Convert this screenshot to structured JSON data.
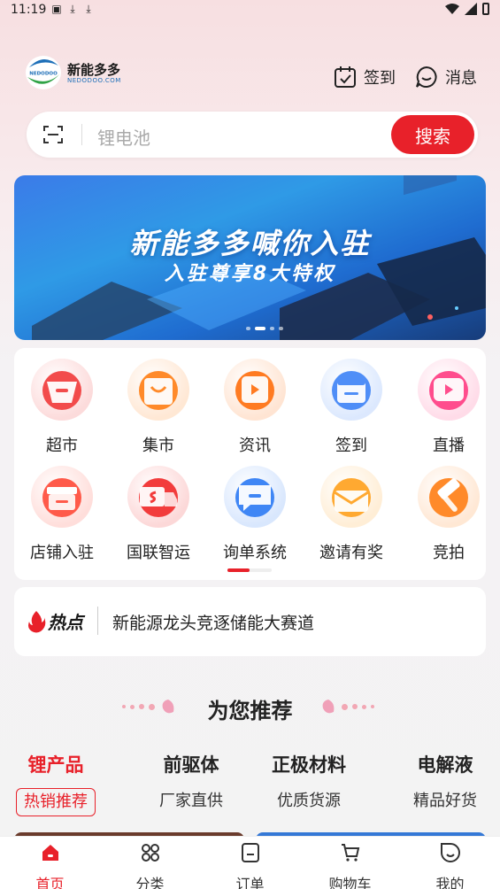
{
  "status_bar": {
    "time": "11:19"
  },
  "header": {
    "logo_text": "新能多多",
    "logo_subtext": "NEDODOO.COM",
    "logo_mark_text": "NEDODOO",
    "checkin_label": "签到",
    "message_label": "消息"
  },
  "search": {
    "placeholder": "锂电池",
    "button_label": "搜索"
  },
  "banner": {
    "title": "新能多多喊你入驻",
    "subtitle": "入驻尊享8大特权",
    "slide_count": 4,
    "active_slide": 2
  },
  "quick_menu": {
    "items": [
      {
        "label": "超市",
        "icon": "basket-icon",
        "color": "#f24b4b"
      },
      {
        "label": "集市",
        "icon": "bag-icon",
        "color": "#ff8a2a"
      },
      {
        "label": "资讯",
        "icon": "news-play-icon",
        "color": "#ff7b22"
      },
      {
        "label": "签到",
        "icon": "calendar-icon",
        "color": "#4f8ef7"
      },
      {
        "label": "直播",
        "icon": "live-play-icon",
        "color": "#ff4d8d"
      },
      {
        "label": "店铺入驻",
        "icon": "store-icon",
        "color": "#ff5a4a"
      },
      {
        "label": "国联智运",
        "icon": "truck-icon",
        "color": "#f23c3c"
      },
      {
        "label": "询单系统",
        "icon": "chat-bubble-icon",
        "color": "#3f86f5"
      },
      {
        "label": "邀请有奖",
        "icon": "envelope-icon",
        "color": "#ffa931"
      },
      {
        "label": "竞拍",
        "icon": "gavel-icon",
        "color": "#ff8a2a"
      }
    ],
    "page_count": 2,
    "active_page": 1
  },
  "news": {
    "tag": "热点",
    "headline": "新能源龙头竞逐储能大赛道"
  },
  "recommend": {
    "title": "为您推荐",
    "categories": [
      {
        "name": "锂产品",
        "sub": "热销推荐",
        "active": true
      },
      {
        "name": "前驱体",
        "sub": "厂家直供",
        "active": false
      },
      {
        "name": "正极材料",
        "sub": "优质货源",
        "active": false
      },
      {
        "name": "电解液",
        "sub": "精品好货",
        "active": false
      }
    ]
  },
  "tabbar": {
    "tabs": [
      {
        "label": "首页",
        "icon": "home-icon",
        "active": true
      },
      {
        "label": "分类",
        "icon": "category-icon",
        "active": false
      },
      {
        "label": "订单",
        "icon": "order-icon",
        "active": false
      },
      {
        "label": "购物车",
        "icon": "cart-icon",
        "active": false
      },
      {
        "label": "我的",
        "icon": "profile-icon",
        "active": false
      }
    ]
  },
  "colors": {
    "accent": "#e8212a",
    "brand_blue": "#1e6fb8"
  }
}
